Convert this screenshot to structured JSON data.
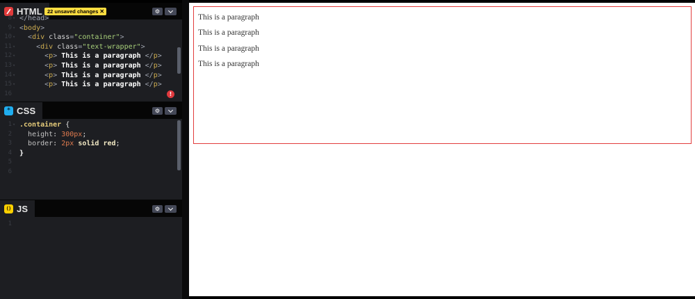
{
  "panels": {
    "html": {
      "title": "HTML",
      "icon": "html-icon",
      "icon_color": "#e23b3b",
      "badge": "22 unsaved changes",
      "badge_close": "✕",
      "settings_icon": "⚙",
      "collapse_icon": "⌄",
      "lines": [
        {
          "n": "8",
          "fold": "▾",
          "segments": [
            {
              "c": "tag",
              "t": "</head>"
            }
          ]
        },
        {
          "n": "9",
          "fold": "▾",
          "segments": [
            {
              "c": "tag",
              "t": "<"
            },
            {
              "c": "tn",
              "t": "body"
            },
            {
              "c": "tag",
              "t": ">"
            }
          ]
        },
        {
          "n": "10",
          "fold": "▾",
          "segments": [
            {
              "c": "plain",
              "t": "  "
            },
            {
              "c": "tag",
              "t": "<"
            },
            {
              "c": "tn",
              "t": "div"
            },
            {
              "c": "plain",
              "t": " "
            },
            {
              "c": "attr",
              "t": "class"
            },
            {
              "c": "tag",
              "t": "="
            },
            {
              "c": "str",
              "t": "\"container\""
            },
            {
              "c": "tag",
              "t": ">"
            }
          ]
        },
        {
          "n": "11",
          "fold": "▾",
          "segments": [
            {
              "c": "plain",
              "t": "    "
            },
            {
              "c": "tag",
              "t": "<"
            },
            {
              "c": "tn",
              "t": "div"
            },
            {
              "c": "plain",
              "t": " "
            },
            {
              "c": "attr",
              "t": "class"
            },
            {
              "c": "tag",
              "t": "="
            },
            {
              "c": "str",
              "t": "\"text-wrapper\""
            },
            {
              "c": "tag",
              "t": ">"
            }
          ]
        },
        {
          "n": "12",
          "fold": "▾",
          "segments": [
            {
              "c": "plain",
              "t": "      "
            },
            {
              "c": "tag",
              "t": "<"
            },
            {
              "c": "tn",
              "t": "p"
            },
            {
              "c": "tag",
              "t": ">"
            },
            {
              "c": "bold",
              "t": " This is a paragraph "
            },
            {
              "c": "tag",
              "t": "</"
            },
            {
              "c": "tn",
              "t": "p"
            },
            {
              "c": "tag",
              "t": ">"
            }
          ]
        },
        {
          "n": "13",
          "fold": "▾",
          "segments": [
            {
              "c": "plain",
              "t": "      "
            },
            {
              "c": "tag",
              "t": "<"
            },
            {
              "c": "tn",
              "t": "p"
            },
            {
              "c": "tag",
              "t": ">"
            },
            {
              "c": "bold",
              "t": " This is a paragraph "
            },
            {
              "c": "tag",
              "t": "</"
            },
            {
              "c": "tn",
              "t": "p"
            },
            {
              "c": "tag",
              "t": ">"
            }
          ]
        },
        {
          "n": "14",
          "fold": "▾",
          "segments": [
            {
              "c": "plain",
              "t": "      "
            },
            {
              "c": "tag",
              "t": "<"
            },
            {
              "c": "tn",
              "t": "p"
            },
            {
              "c": "tag",
              "t": ">"
            },
            {
              "c": "bold",
              "t": " This is a paragraph "
            },
            {
              "c": "tag",
              "t": "</"
            },
            {
              "c": "tn",
              "t": "p"
            },
            {
              "c": "tag",
              "t": ">"
            }
          ]
        },
        {
          "n": "15",
          "fold": "▾",
          "segments": [
            {
              "c": "plain",
              "t": "      "
            },
            {
              "c": "tag",
              "t": "<"
            },
            {
              "c": "tn",
              "t": "p"
            },
            {
              "c": "tag",
              "t": ">"
            },
            {
              "c": "bold",
              "t": " This is a paragraph "
            },
            {
              "c": "tag",
              "t": "</"
            },
            {
              "c": "tn",
              "t": "p"
            },
            {
              "c": "tag",
              "t": ">"
            }
          ]
        },
        {
          "n": "16",
          "fold": "",
          "segments": []
        }
      ],
      "error_icon": "!"
    },
    "css": {
      "title": "CSS",
      "icon": "css-icon",
      "icon_color": "#20aef0",
      "icon_glyph": "*",
      "settings_icon": "⚙",
      "collapse_icon": "⌄",
      "lines": [
        {
          "n": "1",
          "fold": "▾",
          "segments": [
            {
              "c": "sel",
              "t": ".container"
            },
            {
              "c": "plain",
              "t": " {"
            }
          ]
        },
        {
          "n": "2",
          "fold": "",
          "segments": [
            {
              "c": "plain",
              "t": "  "
            },
            {
              "c": "prop",
              "t": "height"
            },
            {
              "c": "plain",
              "t": ": "
            },
            {
              "c": "num",
              "t": "300px"
            },
            {
              "c": "plain",
              "t": ";"
            }
          ]
        },
        {
          "n": "3",
          "fold": "",
          "segments": [
            {
              "c": "plain",
              "t": "  "
            },
            {
              "c": "prop",
              "t": "border"
            },
            {
              "c": "plain",
              "t": ": "
            },
            {
              "c": "num",
              "t": "2px"
            },
            {
              "c": "plain",
              "t": " "
            },
            {
              "c": "val",
              "t": "solid"
            },
            {
              "c": "plain",
              "t": " "
            },
            {
              "c": "val",
              "t": "red"
            },
            {
              "c": "plain",
              "t": ";"
            }
          ]
        },
        {
          "n": "4",
          "fold": "",
          "segments": [
            {
              "c": "bold",
              "t": "}"
            }
          ]
        },
        {
          "n": "5",
          "fold": "",
          "segments": []
        },
        {
          "n": "6",
          "fold": "",
          "segments": []
        }
      ]
    },
    "js": {
      "title": "JS",
      "icon": "js-icon",
      "icon_color": "#fcd000",
      "icon_glyph": "()",
      "settings_icon": "⚙",
      "collapse_icon": "⌄",
      "lines": [
        {
          "n": "1",
          "fold": "",
          "segments": []
        }
      ]
    }
  },
  "preview": {
    "paragraphs": [
      "This is a paragraph",
      "This is a paragraph",
      "This is a paragraph",
      "This is a paragraph"
    ],
    "border_color": "#e23b3b"
  }
}
